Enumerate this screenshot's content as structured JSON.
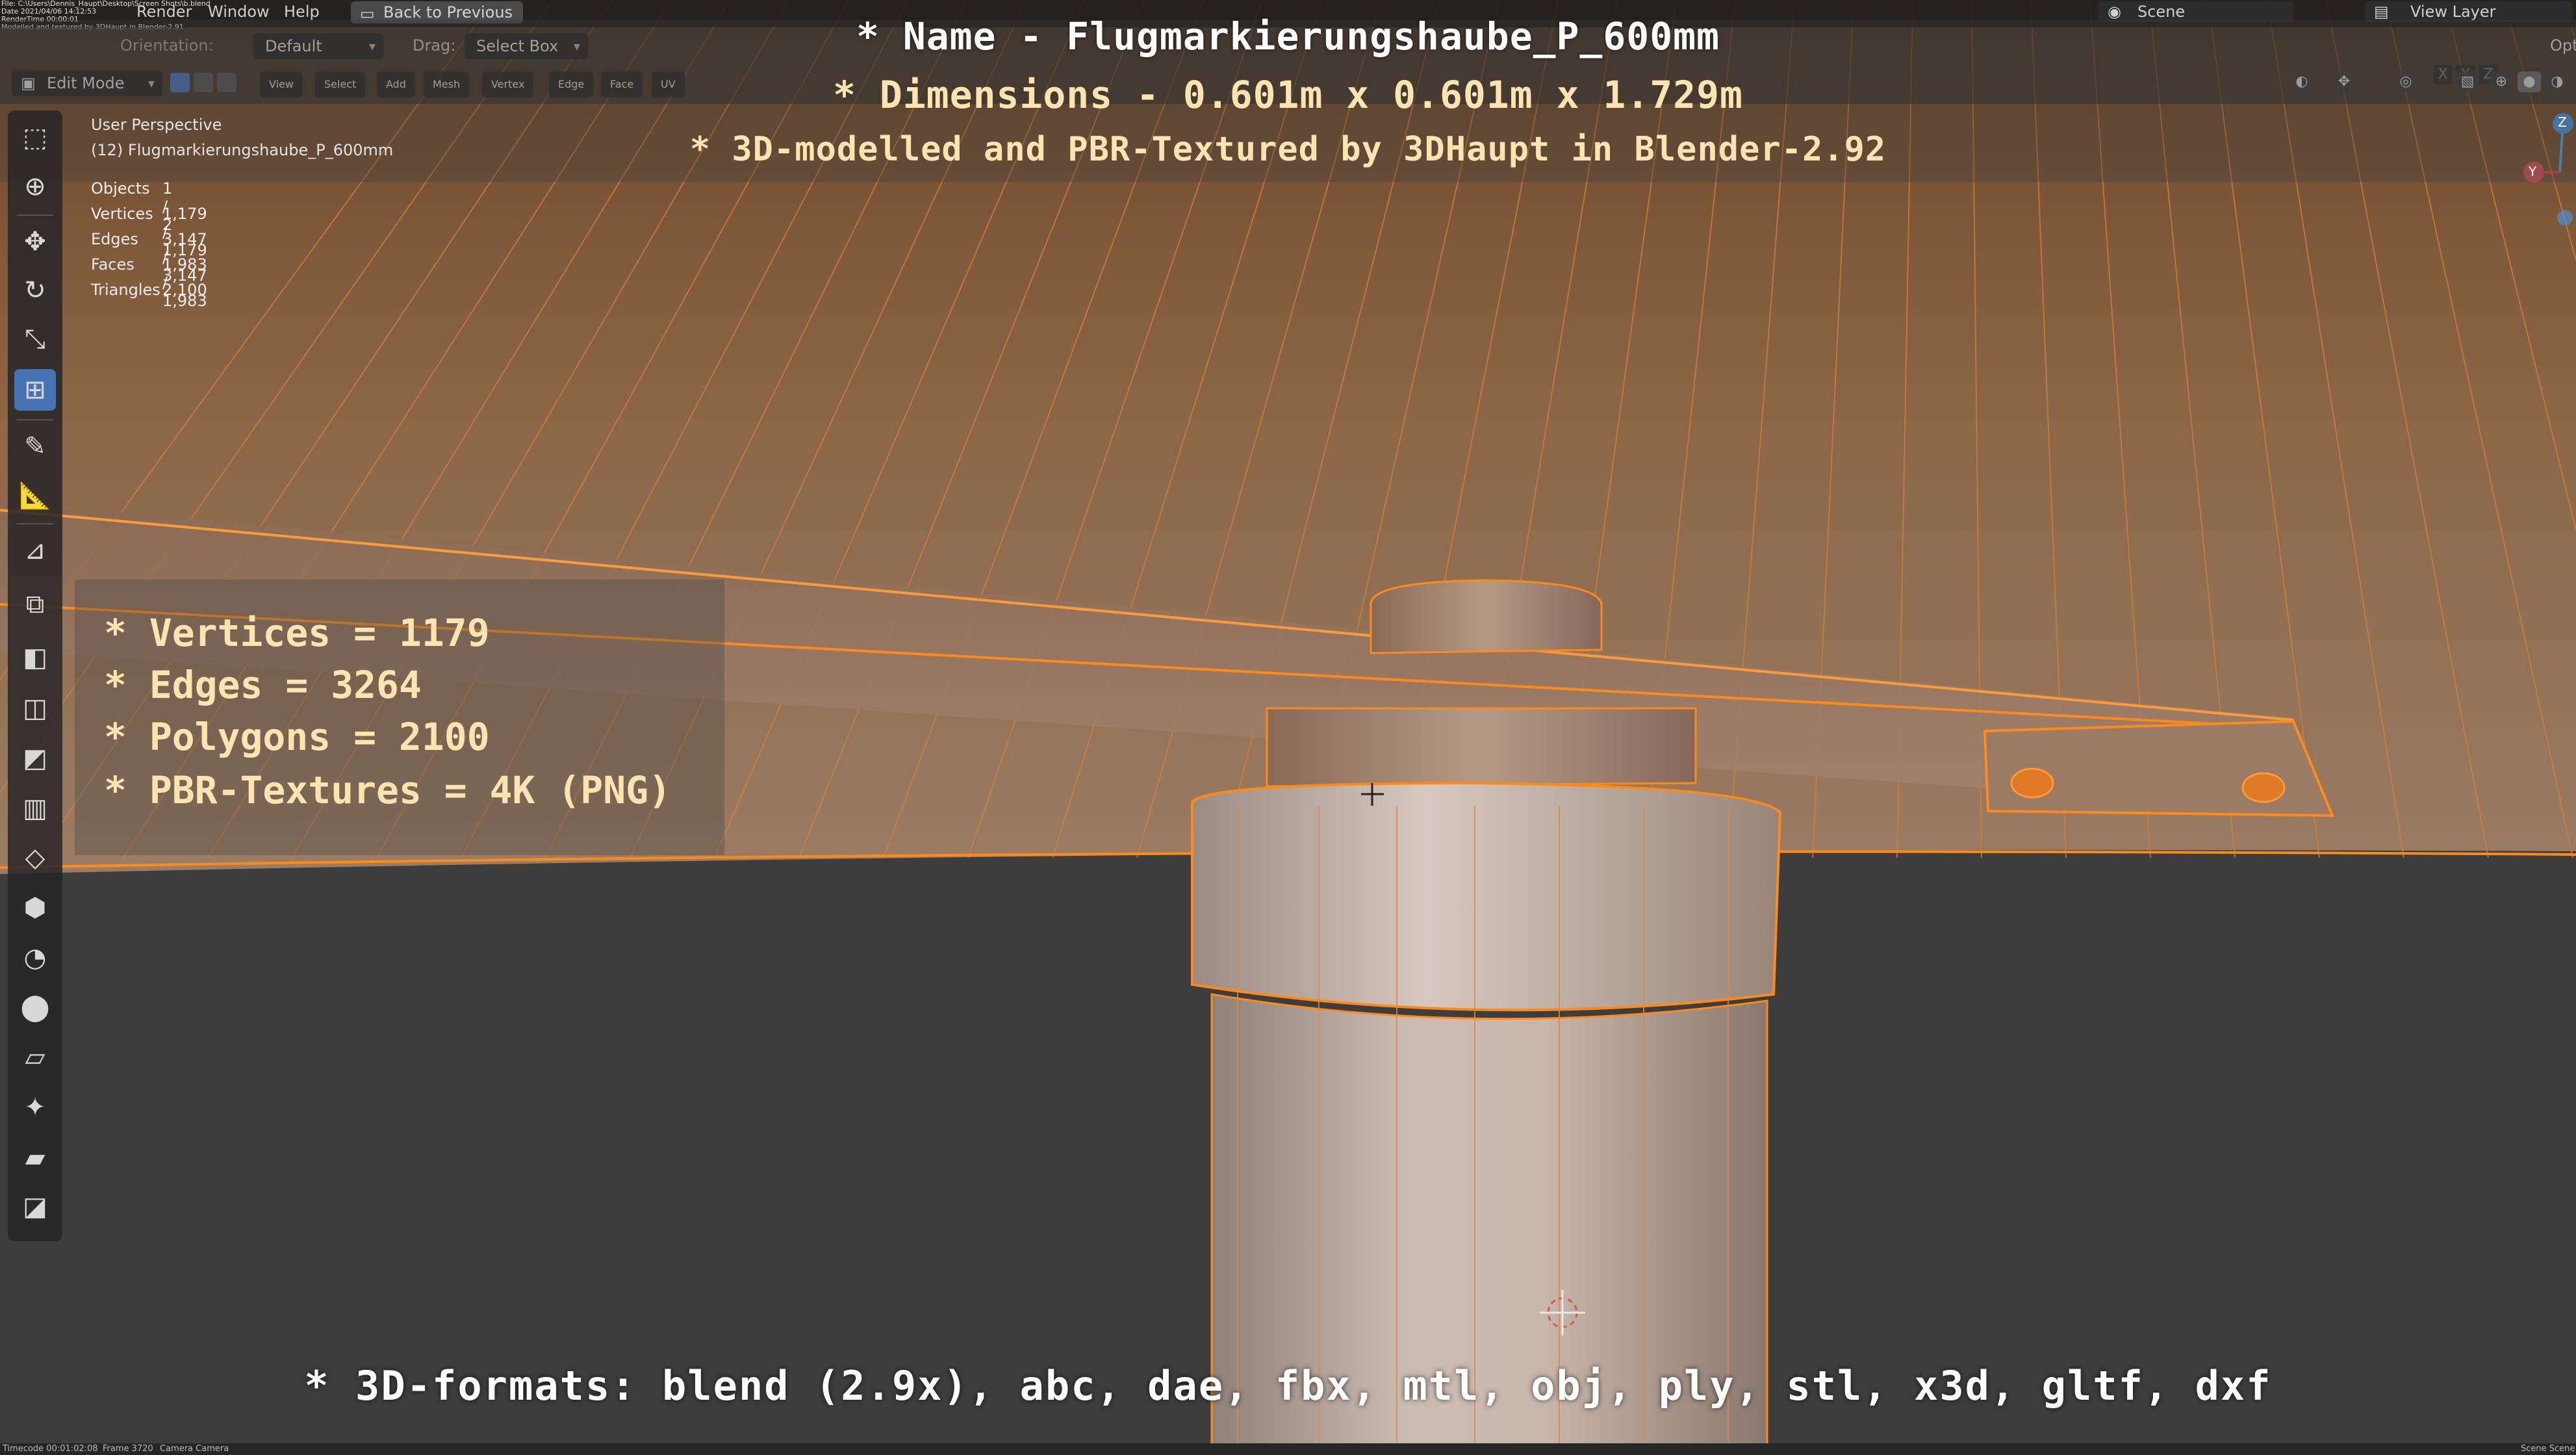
{
  "top_menu": {
    "items": [
      "Render",
      "Window",
      "Help"
    ],
    "back_button": "Back to Previous",
    "scene_label": "Scene",
    "view_layer_label": "View Layer",
    "options_label": "Opt",
    "file_path_lines": [
      "File: C:\\Users\\Dennis_Haupt\\Desktop\\Screen Shots\\b.blend",
      "Date 2021/04/06 14:12:53",
      "RenderTime 00:00:01",
      "Modelled and textured by 3DHaupt in Blender-2.91"
    ]
  },
  "header": {
    "orientation_label": "Orientation:",
    "orientation_value": "Default",
    "drag_label": "Drag:",
    "drag_value": "Select Box",
    "mode_value": "Edit Mode",
    "menus": [
      "View",
      "Select",
      "Add",
      "Mesh",
      "Vertex",
      "Edge",
      "Face",
      "UV"
    ],
    "axis_toggles": [
      "X",
      "Y",
      "Z"
    ]
  },
  "overlay_title": {
    "name": "* Name - Flugmarkierungshaube_P_600mm",
    "dimensions": "* Dimensions -  0.601m x 0.601m x 1.729m",
    "modelled": "* 3D-modelled and PBR-Textured by 3DHaupt in Blender-2.92"
  },
  "viewport": {
    "perspective": "User Perspective",
    "object_name": "(12) Flugmarkierungshaube_P_600mm",
    "stats": [
      {
        "label": "Objects",
        "value": "1 / 2"
      },
      {
        "label": "Vertices",
        "value": "1,179 / 1,179"
      },
      {
        "label": "Edges",
        "value": "3,147 / 3,147"
      },
      {
        "label": "Faces",
        "value": "1,983 / 1,983"
      },
      {
        "label": "Triangles",
        "value": "2,100"
      }
    ]
  },
  "features": {
    "vertices": "* Vertices = 1179",
    "edges": "* Edges = 3264",
    "polygons": "* Polygons = 2100",
    "textures": "* PBR-Textures = 4K (PNG)"
  },
  "formats_line": "* 3D-formats: blend (2.9x), abc, dae, fbx, mtl, obj, ply, stl, x3d, gltf, dxf",
  "status_bar": {
    "left": "Timecode 00:01:02:08",
    "frame": "Frame 3720",
    "camera": "Camera Camera",
    "right": "Scene Scene"
  },
  "gizmo": {
    "axes": [
      "Z",
      "Y"
    ]
  },
  "colors": {
    "wire": "#ff8a1c",
    "surface": "#c7b8ad",
    "active_tool": "#4772b3",
    "text_highlight": "#ffe3b0"
  }
}
